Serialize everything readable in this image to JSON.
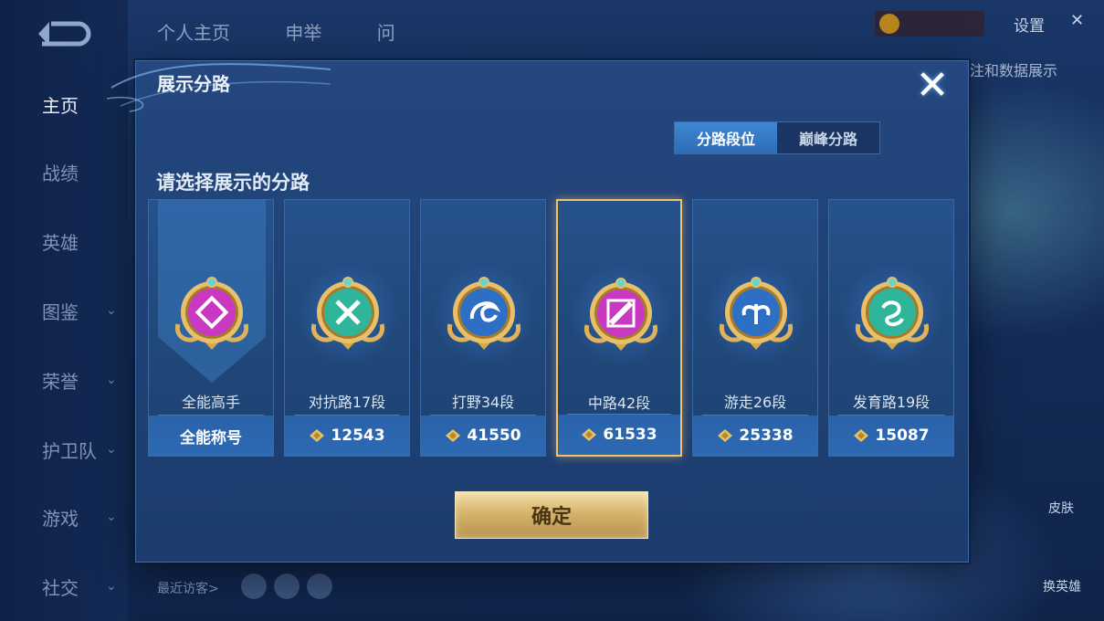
{
  "background": {
    "nav_items": [
      {
        "label": "主页",
        "active": true,
        "chevron": false
      },
      {
        "label": "战绩",
        "active": false,
        "chevron": false
      },
      {
        "label": "英雄",
        "active": false,
        "chevron": false
      },
      {
        "label": "图鉴",
        "active": false,
        "chevron": true
      },
      {
        "label": "荣誉",
        "active": false,
        "chevron": true
      },
      {
        "label": "护卫队",
        "active": false,
        "chevron": true
      },
      {
        "label": "游戏",
        "active": false,
        "chevron": true
      },
      {
        "label": "社交",
        "active": false,
        "chevron": true
      }
    ],
    "top_tabs": [
      "个人主页",
      "申举",
      "问"
    ],
    "settings_label": "设置",
    "data_show_label": "注和数据展示",
    "visitors_label": "最近访客>",
    "skin_label": "皮肤",
    "hero_switch_label": "换英雄"
  },
  "dialog": {
    "title": "展示分路",
    "close_symbol": "✕",
    "segment": {
      "options": [
        "分路段位",
        "巅峰分路"
      ],
      "selected": "分路段位"
    },
    "subtitle": "请选择展示的分路",
    "confirm_label": "确定",
    "cards": [
      {
        "name": "全能高手",
        "foot": "全能称号",
        "points": null,
        "badge_color": "#c838c0",
        "selected": false
      },
      {
        "name": "对抗路17段",
        "foot": "12543",
        "points": 12543,
        "badge_color": "#2fb59a",
        "selected": false
      },
      {
        "name": "打野34段",
        "foot": "41550",
        "points": 41550,
        "badge_color": "#2e6fc6",
        "selected": false
      },
      {
        "name": "中路42段",
        "foot": "61533",
        "points": 61533,
        "badge_color": "#c838c0",
        "selected": true
      },
      {
        "name": "游走26段",
        "foot": "25338",
        "points": 25338,
        "badge_color": "#2e6fc6",
        "selected": false
      },
      {
        "name": "发育路19段",
        "foot": "15087",
        "points": 15087,
        "badge_color": "#2fb59a",
        "selected": false
      }
    ]
  },
  "colors": {
    "accent_gold": "#f0c26a",
    "segment_active": "#3f86d2",
    "dialog_bg": "#1f4276"
  }
}
